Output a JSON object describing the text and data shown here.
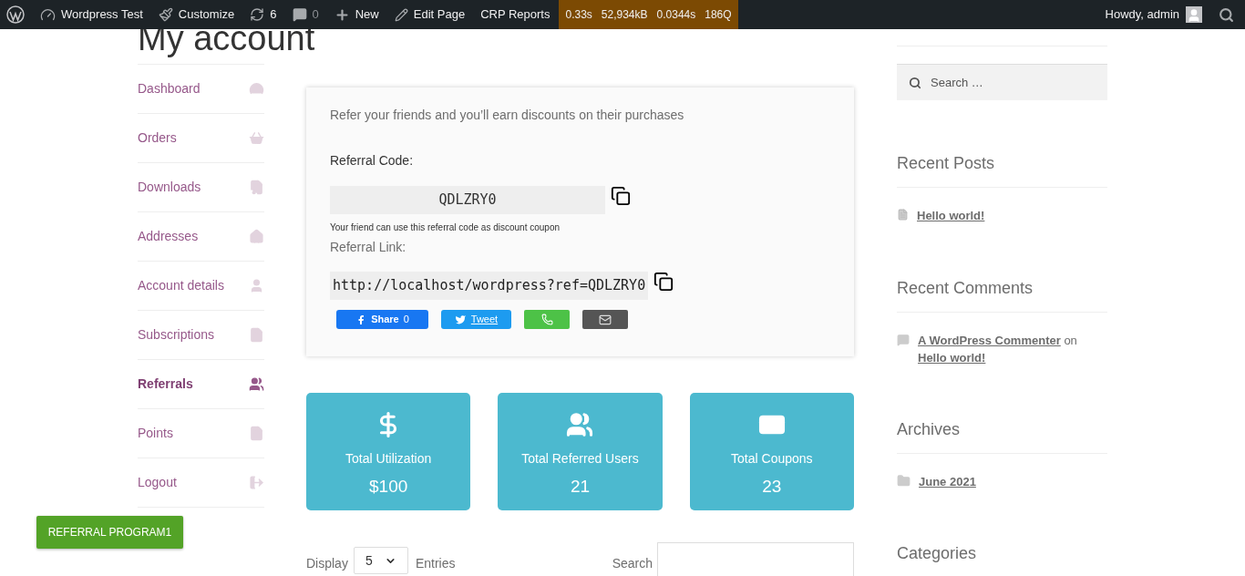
{
  "admin_bar": {
    "site": "Wordpress Test",
    "customize": "Customize",
    "updates": "6",
    "comments": "0",
    "new": "New",
    "edit": "Edit Page",
    "reports": "CRP Reports",
    "stats": [
      "0.33s",
      "52,934kB",
      "0.0344s",
      "186Q"
    ],
    "greeting": "Howdy, admin"
  },
  "page_title": "My account",
  "nav": [
    {
      "label": "Dashboard",
      "selected": false
    },
    {
      "label": "Orders",
      "selected": false
    },
    {
      "label": "Downloads",
      "selected": false
    },
    {
      "label": "Addresses",
      "selected": false
    },
    {
      "label": "Account details",
      "selected": false
    },
    {
      "label": "Subscriptions",
      "selected": false
    },
    {
      "label": "Referrals",
      "selected": true
    },
    {
      "label": "Points",
      "selected": false
    },
    {
      "label": "Logout",
      "selected": false
    }
  ],
  "referral": {
    "intro": "Refer your friends and you’ll earn discounts on their purchases",
    "code_label": "Referral Code:",
    "code": "QDLZRY0",
    "code_hint": "Your friend can use this referral code as discount coupon",
    "link_label": "Referral Link:",
    "link": "http://localhost/wordpress?ref=QDLZRY0",
    "share": [
      {
        "kind": "facebook",
        "label": "Share",
        "count": "0"
      },
      {
        "kind": "twitter",
        "label": "Tweet"
      },
      {
        "kind": "whatsapp"
      },
      {
        "kind": "email"
      }
    ]
  },
  "stats": [
    {
      "label": "Total Utilization",
      "value": "$100"
    },
    {
      "label": "Total Referred Users",
      "value": "21"
    },
    {
      "label": "Total Coupons",
      "value": "23"
    }
  ],
  "table_controls": {
    "display": "Display",
    "entries_value": "5",
    "entries": "Entries",
    "search": "Search"
  },
  "floating_button": "REFERRAL PROGRAM1",
  "sidebar": {
    "search_placeholder": "Search …",
    "widgets": [
      {
        "title": "Recent Posts",
        "items": [
          {
            "kind": "post",
            "link": "Hello world!"
          }
        ]
      },
      {
        "title": "Recent Comments",
        "items": [
          {
            "kind": "comment",
            "author": "A WordPress Commenter",
            "joiner": "on",
            "link": "Hello world!"
          }
        ]
      },
      {
        "title": "Archives",
        "items": [
          {
            "kind": "archive",
            "link": "June 2021"
          }
        ]
      },
      {
        "title": "Categories"
      }
    ]
  }
}
